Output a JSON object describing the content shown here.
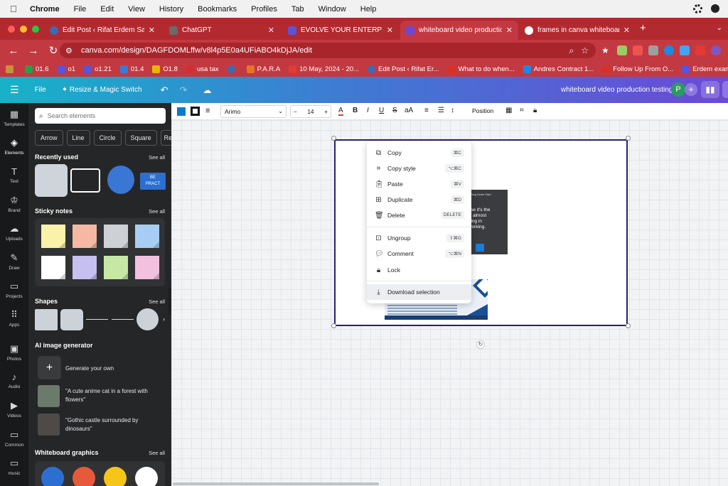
{
  "menubar": {
    "app": "Chrome",
    "items": [
      "File",
      "Edit",
      "View",
      "History",
      "Bookmarks",
      "Profiles",
      "Tab",
      "Window",
      "Help"
    ]
  },
  "tabs": [
    {
      "title": "Edit Post ‹ Rifat Erdem Sahin",
      "active": false,
      "icon": "wordpress-icon",
      "color": "#3b6bb5"
    },
    {
      "title": "ChatGPT",
      "active": false,
      "icon": "chatgpt-icon",
      "color": "#6a6a6a"
    },
    {
      "title": "EVOLVE YOUR ENTERPRISE D",
      "active": false,
      "icon": "badge-icon",
      "color": "#5a54d8"
    },
    {
      "title": "whiteboard video production",
      "active": true,
      "icon": "canva-icon",
      "color": "#6b49d6"
    },
    {
      "title": "frames in canva whiteboard -",
      "active": false,
      "icon": "google-icon",
      "color": "#ffffff"
    }
  ],
  "address": {
    "url": "canva.com/design/DAGFDOMLffw/v8l4p5E0a4UFiABO4kDjJA/edit"
  },
  "bookmarks": [
    {
      "label": "01.6",
      "color": "#2e9b4a"
    },
    {
      "label": "o1",
      "color": "#5a54d8"
    },
    {
      "label": "o1.21",
      "color": "#5a54d8"
    },
    {
      "label": "01.4",
      "color": "#3a7bd5"
    },
    {
      "label": "O1.8",
      "color": "#e8b600"
    },
    {
      "label": "usa tax",
      "color": "#d32f2f"
    },
    {
      "label": "",
      "color": "#3b6bb5"
    },
    {
      "label": "P.A.R.A",
      "color": "#e57325"
    },
    {
      "label": "10 May, 2024 - 20...",
      "color": "#e53935"
    },
    {
      "label": "Edit Post ‹ Rifat Er...",
      "color": "#3b6bb5"
    },
    {
      "label": "What to do when...",
      "color": "#d93025"
    },
    {
      "label": "Andres Contract 1...",
      "color": "#1e88e5"
    },
    {
      "label": "Follow Up From O...",
      "color": "#d93025"
    },
    {
      "label": "Erdem exam fail st...",
      "color": "#5a54d8"
    }
  ],
  "canva": {
    "file": "File",
    "resize": "Resize & Magic Switch",
    "doc_title": "whiteboard video production testing",
    "avatar": "P",
    "plus": "+"
  },
  "rail": [
    {
      "label": "Templates",
      "icon": "templates-icon",
      "glyph": "▦"
    },
    {
      "label": "Elements",
      "icon": "elements-icon",
      "glyph": "◈"
    },
    {
      "label": "Text",
      "icon": "text-icon",
      "glyph": "T"
    },
    {
      "label": "Brand",
      "icon": "brand-icon",
      "glyph": "♔"
    },
    {
      "label": "Uploads",
      "icon": "uploads-icon",
      "glyph": "☁"
    },
    {
      "label": "Draw",
      "icon": "draw-icon",
      "glyph": "✎"
    },
    {
      "label": "Projects",
      "icon": "projects-icon",
      "glyph": "▭"
    },
    {
      "label": "Apps",
      "icon": "apps-icon",
      "glyph": "⠿"
    },
    {
      "label": "Photos",
      "icon": "photos-icon",
      "glyph": "▣"
    },
    {
      "label": "Audio",
      "icon": "audio-icon",
      "glyph": "♪"
    },
    {
      "label": "Videos",
      "icon": "videos-icon",
      "glyph": "▶"
    },
    {
      "label": "Common",
      "icon": "common-icon",
      "glyph": "▭"
    },
    {
      "label": "music",
      "icon": "music-folder-icon",
      "glyph": "▭"
    }
  ],
  "panel": {
    "search_placeholder": "Search elements",
    "chips": [
      "Arrow",
      "Line",
      "Circle",
      "Square",
      "Rec"
    ],
    "recently_used": "Recently used",
    "see_all": "See all",
    "sticky_notes": "Sticky notes",
    "shapes": "Shapes",
    "ai_generator": "AI image generator",
    "generate_own": "Generate your own",
    "ai_prompt_1": "\"A cute anime cat in a forest with flowers\"",
    "ai_prompt_2": "\"Gothic castle surrounded by dinosaurs\"",
    "whiteboard_graphics": "Whiteboard graphics",
    "recent_thumb_text": "BE\nPRACT"
  },
  "toolbar2": {
    "font": "Arimo",
    "size": "14",
    "minus": "−",
    "plus": "+",
    "position": "Position",
    "colors": {
      "fill": "#0b79d0",
      "border": "#111111"
    }
  },
  "canvas": {
    "card_text": "ecause it's the\nsis of almost\nerything in\noodworking.",
    "card_mini": "Blog Scale   Start",
    "page_border_color": "#2a1d7a"
  },
  "context_menu": [
    {
      "label": "Copy",
      "shortcut": "⌘C",
      "icon": "copy-icon"
    },
    {
      "label": "Copy style",
      "shortcut": "⌥⌘C",
      "icon": "paint-roller-icon"
    },
    {
      "label": "Paste",
      "shortcut": "⌘V",
      "icon": "clipboard-icon"
    },
    {
      "label": "Duplicate",
      "shortcut": "⌘D",
      "icon": "duplicate-icon"
    },
    {
      "label": "Delete",
      "shortcut": "DELETE",
      "icon": "trash-icon"
    },
    {
      "label": "Ungroup",
      "shortcut": "⇧⌘G",
      "icon": "ungroup-icon"
    },
    {
      "label": "Comment",
      "shortcut": "⌥⌘N",
      "icon": "comment-icon"
    },
    {
      "label": "Lock",
      "shortcut": "",
      "icon": "lock-icon"
    },
    {
      "label": "Download selection",
      "shortcut": "",
      "icon": "download-icon"
    }
  ]
}
